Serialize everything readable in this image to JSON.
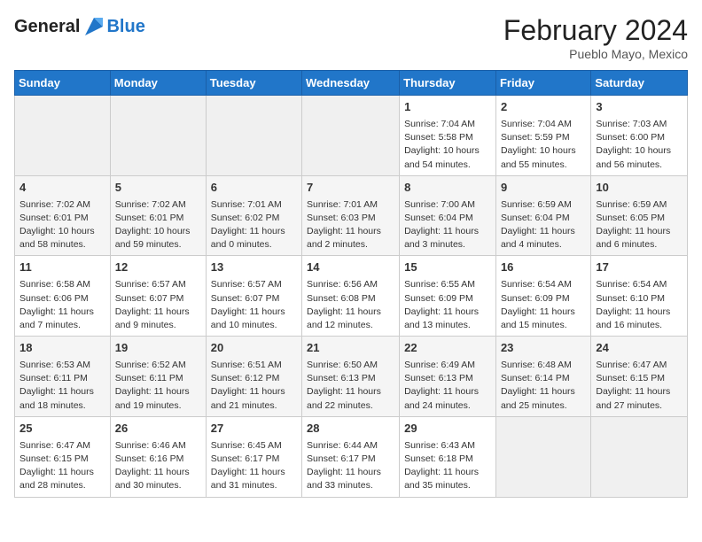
{
  "header": {
    "logo_general": "General",
    "logo_blue": "Blue",
    "month_title": "February 2024",
    "subtitle": "Pueblo Mayo, Mexico"
  },
  "days_of_week": [
    "Sunday",
    "Monday",
    "Tuesday",
    "Wednesday",
    "Thursday",
    "Friday",
    "Saturday"
  ],
  "weeks": [
    [
      {
        "day": "",
        "info": ""
      },
      {
        "day": "",
        "info": ""
      },
      {
        "day": "",
        "info": ""
      },
      {
        "day": "",
        "info": ""
      },
      {
        "day": "1",
        "info": "Sunrise: 7:04 AM\nSunset: 5:58 PM\nDaylight: 10 hours and 54 minutes."
      },
      {
        "day": "2",
        "info": "Sunrise: 7:04 AM\nSunset: 5:59 PM\nDaylight: 10 hours and 55 minutes."
      },
      {
        "day": "3",
        "info": "Sunrise: 7:03 AM\nSunset: 6:00 PM\nDaylight: 10 hours and 56 minutes."
      }
    ],
    [
      {
        "day": "4",
        "info": "Sunrise: 7:02 AM\nSunset: 6:01 PM\nDaylight: 10 hours and 58 minutes."
      },
      {
        "day": "5",
        "info": "Sunrise: 7:02 AM\nSunset: 6:01 PM\nDaylight: 10 hours and 59 minutes."
      },
      {
        "day": "6",
        "info": "Sunrise: 7:01 AM\nSunset: 6:02 PM\nDaylight: 11 hours and 0 minutes."
      },
      {
        "day": "7",
        "info": "Sunrise: 7:01 AM\nSunset: 6:03 PM\nDaylight: 11 hours and 2 minutes."
      },
      {
        "day": "8",
        "info": "Sunrise: 7:00 AM\nSunset: 6:04 PM\nDaylight: 11 hours and 3 minutes."
      },
      {
        "day": "9",
        "info": "Sunrise: 6:59 AM\nSunset: 6:04 PM\nDaylight: 11 hours and 4 minutes."
      },
      {
        "day": "10",
        "info": "Sunrise: 6:59 AM\nSunset: 6:05 PM\nDaylight: 11 hours and 6 minutes."
      }
    ],
    [
      {
        "day": "11",
        "info": "Sunrise: 6:58 AM\nSunset: 6:06 PM\nDaylight: 11 hours and 7 minutes."
      },
      {
        "day": "12",
        "info": "Sunrise: 6:57 AM\nSunset: 6:07 PM\nDaylight: 11 hours and 9 minutes."
      },
      {
        "day": "13",
        "info": "Sunrise: 6:57 AM\nSunset: 6:07 PM\nDaylight: 11 hours and 10 minutes."
      },
      {
        "day": "14",
        "info": "Sunrise: 6:56 AM\nSunset: 6:08 PM\nDaylight: 11 hours and 12 minutes."
      },
      {
        "day": "15",
        "info": "Sunrise: 6:55 AM\nSunset: 6:09 PM\nDaylight: 11 hours and 13 minutes."
      },
      {
        "day": "16",
        "info": "Sunrise: 6:54 AM\nSunset: 6:09 PM\nDaylight: 11 hours and 15 minutes."
      },
      {
        "day": "17",
        "info": "Sunrise: 6:54 AM\nSunset: 6:10 PM\nDaylight: 11 hours and 16 minutes."
      }
    ],
    [
      {
        "day": "18",
        "info": "Sunrise: 6:53 AM\nSunset: 6:11 PM\nDaylight: 11 hours and 18 minutes."
      },
      {
        "day": "19",
        "info": "Sunrise: 6:52 AM\nSunset: 6:11 PM\nDaylight: 11 hours and 19 minutes."
      },
      {
        "day": "20",
        "info": "Sunrise: 6:51 AM\nSunset: 6:12 PM\nDaylight: 11 hours and 21 minutes."
      },
      {
        "day": "21",
        "info": "Sunrise: 6:50 AM\nSunset: 6:13 PM\nDaylight: 11 hours and 22 minutes."
      },
      {
        "day": "22",
        "info": "Sunrise: 6:49 AM\nSunset: 6:13 PM\nDaylight: 11 hours and 24 minutes."
      },
      {
        "day": "23",
        "info": "Sunrise: 6:48 AM\nSunset: 6:14 PM\nDaylight: 11 hours and 25 minutes."
      },
      {
        "day": "24",
        "info": "Sunrise: 6:47 AM\nSunset: 6:15 PM\nDaylight: 11 hours and 27 minutes."
      }
    ],
    [
      {
        "day": "25",
        "info": "Sunrise: 6:47 AM\nSunset: 6:15 PM\nDaylight: 11 hours and 28 minutes."
      },
      {
        "day": "26",
        "info": "Sunrise: 6:46 AM\nSunset: 6:16 PM\nDaylight: 11 hours and 30 minutes."
      },
      {
        "day": "27",
        "info": "Sunrise: 6:45 AM\nSunset: 6:17 PM\nDaylight: 11 hours and 31 minutes."
      },
      {
        "day": "28",
        "info": "Sunrise: 6:44 AM\nSunset: 6:17 PM\nDaylight: 11 hours and 33 minutes."
      },
      {
        "day": "29",
        "info": "Sunrise: 6:43 AM\nSunset: 6:18 PM\nDaylight: 11 hours and 35 minutes."
      },
      {
        "day": "",
        "info": ""
      },
      {
        "day": "",
        "info": ""
      }
    ]
  ]
}
